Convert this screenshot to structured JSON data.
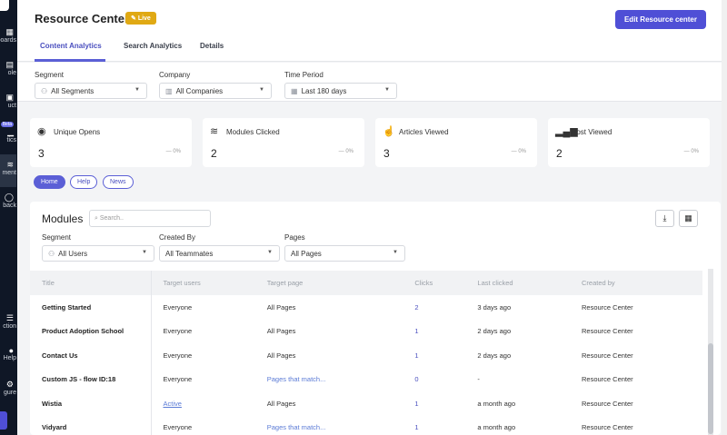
{
  "sidebar": {
    "items": [
      {
        "label": "boards"
      },
      {
        "label": "ole"
      },
      {
        "label": "uct"
      },
      {
        "label": "tics",
        "badge": "Beta"
      },
      {
        "label": "ment"
      },
      {
        "label": "back"
      },
      {
        "label": "ction"
      },
      {
        "label": "Help"
      },
      {
        "label": "gure"
      }
    ]
  },
  "header": {
    "title": "Resource Center",
    "status": "Live",
    "edit_button": "Edit Resource center",
    "tabs": [
      "Content Analytics",
      "Search Analytics",
      "Details"
    ]
  },
  "filters": {
    "segment_label": "Segment",
    "segment_value": "All Segments",
    "company_label": "Company",
    "company_value": "All Companies",
    "period_label": "Time Period",
    "period_value": "Last 180 days"
  },
  "cards": [
    {
      "label": "Unique Opens",
      "value": "3",
      "change": "— 0%"
    },
    {
      "label": "Modules Clicked",
      "value": "2",
      "change": "— 0%"
    },
    {
      "label": "Articles Viewed",
      "value": "3",
      "change": "— 0%"
    },
    {
      "label": "Post Viewed",
      "value": "2",
      "change": "— 0%"
    }
  ],
  "pills": [
    "Home",
    "Help",
    "News"
  ],
  "modules": {
    "title": "Modules",
    "search_placeholder": "Search..",
    "segment_label": "Segment",
    "segment_value": "All Users",
    "created_label": "Created By",
    "created_value": "All Teammates",
    "pages_label": "Pages",
    "pages_value": "All Pages",
    "columns": [
      "Title",
      "Target users",
      "Target page",
      "Clicks",
      "Last clicked",
      "Created by"
    ],
    "rows": [
      [
        "Getting Started",
        "Everyone",
        "All Pages",
        "2",
        "3 days ago",
        "Resource Center"
      ],
      [
        "Product Adoption School",
        "Everyone",
        "All Pages",
        "1",
        "2 days ago",
        "Resource Center"
      ],
      [
        "Contact Us",
        "Everyone",
        "All Pages",
        "1",
        "2 days ago",
        "Resource Center"
      ],
      [
        "Custom JS - flow ID:18",
        "Everyone",
        "Pages that match...",
        "0",
        "-",
        "Resource Center"
      ],
      [
        "Wistia",
        "Active",
        "All Pages",
        "1",
        "a month ago",
        "Resource Center"
      ],
      [
        "Vidyard",
        "Everyone",
        "Pages that match...",
        "1",
        "a month ago",
        "Resource Center"
      ]
    ]
  }
}
